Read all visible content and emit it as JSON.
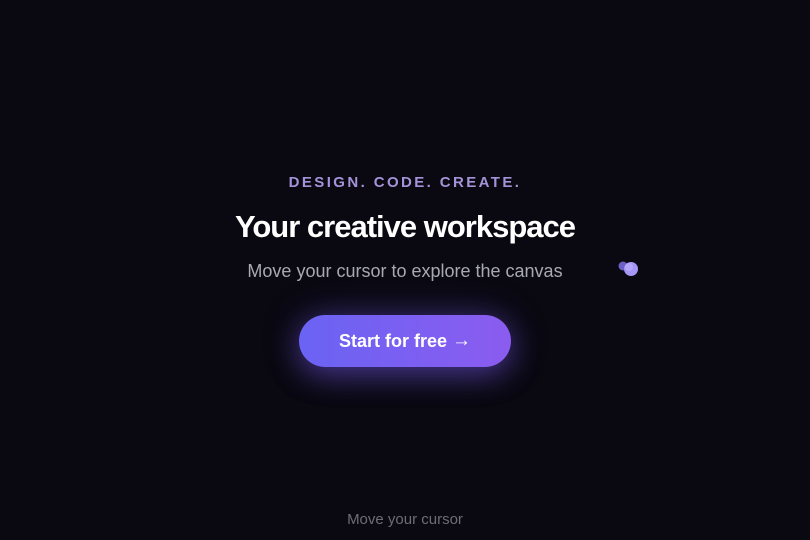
{
  "hero": {
    "eyebrow": "DESIGN. CODE. CREATE.",
    "headline": "Your creative workspace",
    "subline": "Move your cursor to explore the canvas"
  },
  "cta": {
    "label": "Start for free",
    "arrow": "→"
  },
  "footer": {
    "hint": "Move your cursor"
  },
  "colors": {
    "background": "#0a0911",
    "accent": "#8b5cf0",
    "eyebrow": "#a593d9",
    "cursor": "#9b8cf5"
  },
  "icons": {
    "cursor_trail": "cursor-trail-icon"
  }
}
